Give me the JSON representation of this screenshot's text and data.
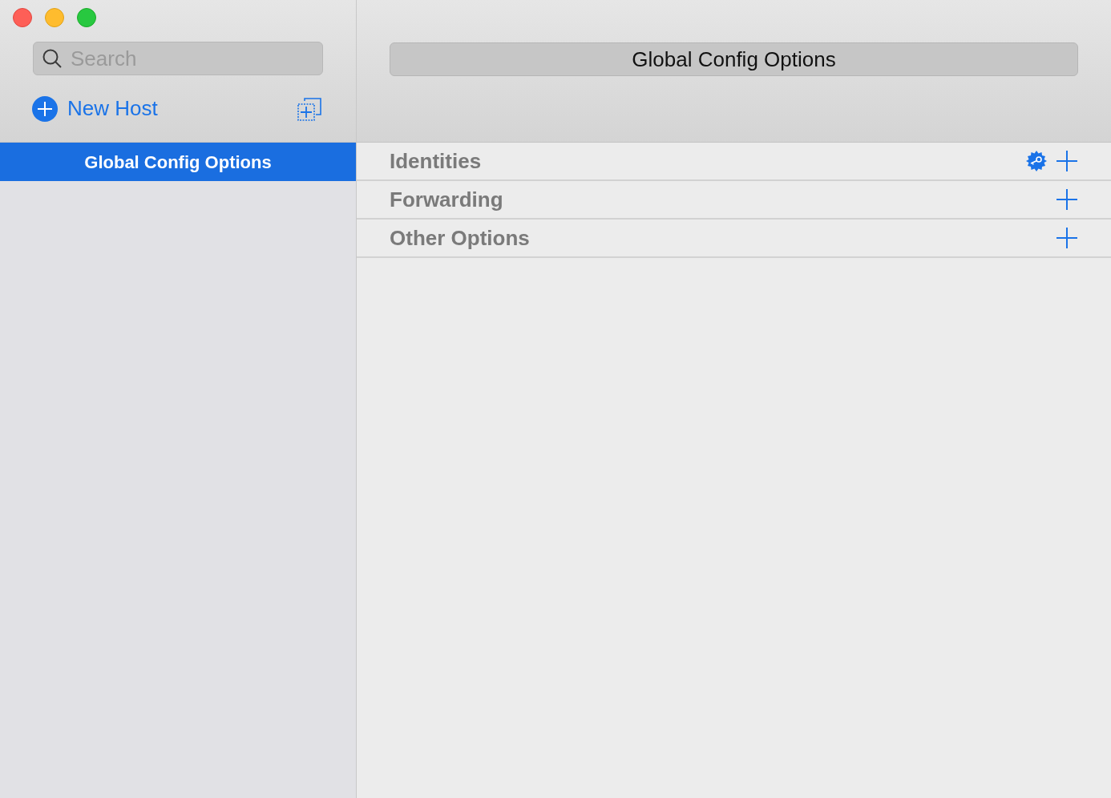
{
  "sidebar": {
    "search": {
      "placeholder": "Search"
    },
    "new_host": "New Host",
    "hosts": [
      {
        "label": "Global Config Options",
        "selected": true
      }
    ]
  },
  "detail": {
    "title": "Global Config Options",
    "sections": [
      {
        "label": "Identities",
        "key_button": true
      },
      {
        "label": "Forwarding",
        "key_button": false
      },
      {
        "label": "Other Options",
        "key_button": false
      }
    ]
  }
}
